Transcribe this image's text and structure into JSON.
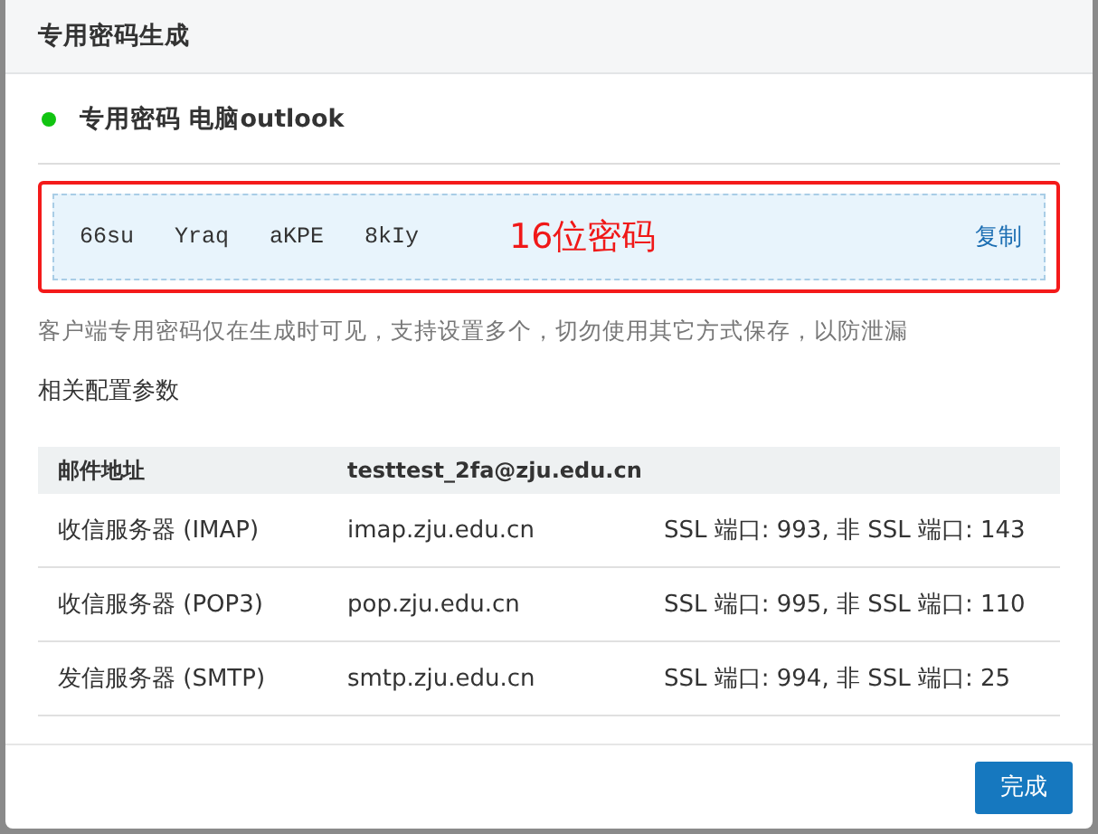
{
  "dialog": {
    "title": "专用密码生成"
  },
  "app_password": {
    "color": "#11c411",
    "label": "专用密码 电脑outlook"
  },
  "password_box": {
    "highlighted": true,
    "groups": [
      "66su",
      "Yraq",
      "aKPE",
      "8kIy"
    ],
    "annotation": "16位密码",
    "copy_link": "复制"
  },
  "notice": "客户端专用密码仅在生成时可见，支持设置多个，切勿使用其它方式保存，以防泄漏",
  "section_title": "相关配置参数",
  "table": {
    "header": [
      "邮件地址",
      "testtest_2fa@zju.edu.cn"
    ],
    "rows": [
      [
        "收信服务器 (IMAP)",
        "imap.zju.edu.cn",
        "SSL 端口: 993, 非 SSL 端口: 143"
      ],
      [
        "收信服务器 (POP3)",
        "pop.zju.edu.cn",
        "SSL 端口: 995, 非 SSL 端口: 110"
      ],
      [
        "发信服务器 (SMTP)",
        "smtp.zju.edu.cn",
        "SSL 端口: 994, 非 SSL 端口: 25"
      ]
    ]
  },
  "buttons": [
    "完成"
  ]
}
